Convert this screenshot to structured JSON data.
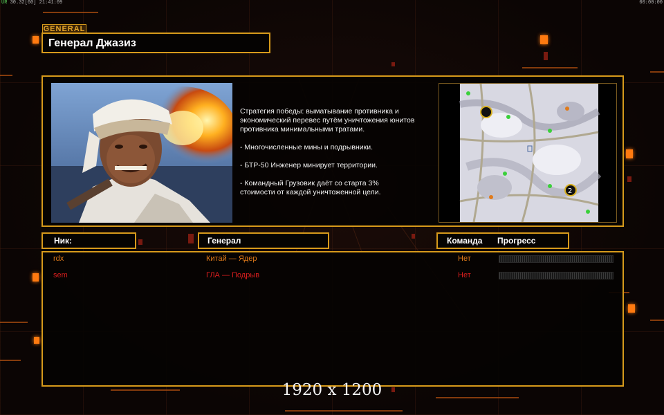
{
  "hud": {
    "left_prefix": "UR",
    "left_stats": "30.32[60] 21:41:09",
    "right_clock": "00:00:00"
  },
  "general": {
    "tag": "GENERAL",
    "name": "Генерал Джазиз",
    "description": [
      "Стратегия победы: выматывание противника и\n экономический перевес путём уничтожения юнитов\n противника минимальными тратами.",
      "- Многочисленные мины и подрывники.",
      "- БТР-50 Инженер минирует территории.",
      "- Командный Грузовик даёт со старта 3%\n стоимости от каждой уничтоженной цели."
    ]
  },
  "columns": {
    "nick": "Ник:",
    "general": "Генерал",
    "team": "Команда",
    "progress": "Прогресс"
  },
  "players": [
    {
      "nick": "rdx",
      "general": "Китай — Ядер",
      "team": "Нет",
      "color": "#e07a1a",
      "progress": 0
    },
    {
      "nick": "sem",
      "general": "ГЛА — Подрыв",
      "team": "Нет",
      "color": "#d81e1e",
      "progress": 0
    }
  ],
  "resolution": "1920 x 1200",
  "map": {
    "marker1": "1",
    "marker2": "2"
  }
}
